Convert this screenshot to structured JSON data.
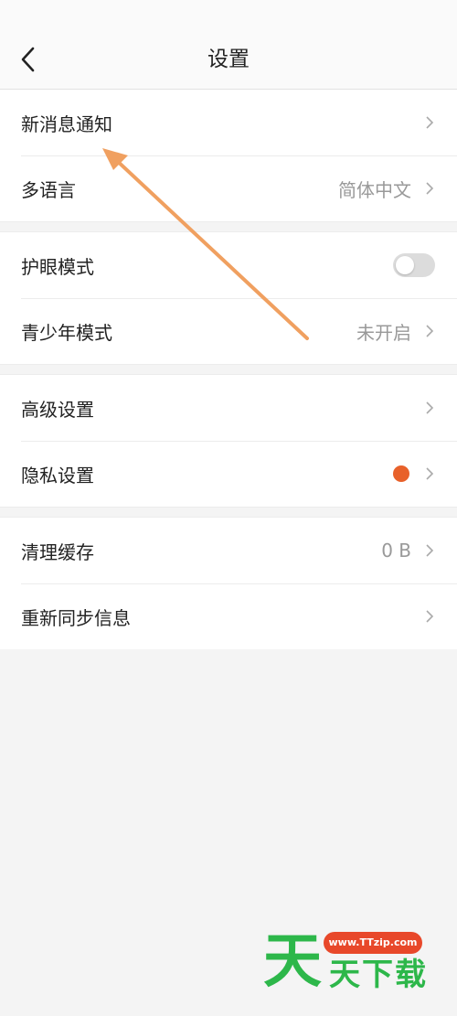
{
  "header": {
    "title": "设置"
  },
  "groups": [
    [
      {
        "label": "新消息通知",
        "value": ""
      },
      {
        "label": "多语言",
        "value": "简体中文"
      }
    ],
    [
      {
        "label": "护眼模式",
        "toggle": false
      },
      {
        "label": "青少年模式",
        "value": "未开启"
      }
    ],
    [
      {
        "label": "高级设置",
        "value": ""
      },
      {
        "label": "隐私设置",
        "dot_color": "#e8612a"
      }
    ],
    [
      {
        "label": "清理缓存",
        "value": "0 B"
      },
      {
        "label": "重新同步信息",
        "value": ""
      }
    ]
  ],
  "annotation": {
    "arrow_color": "#f0a060"
  },
  "watermark": {
    "big": "天",
    "pill": "www.TTzip.com",
    "small": "天下载"
  }
}
